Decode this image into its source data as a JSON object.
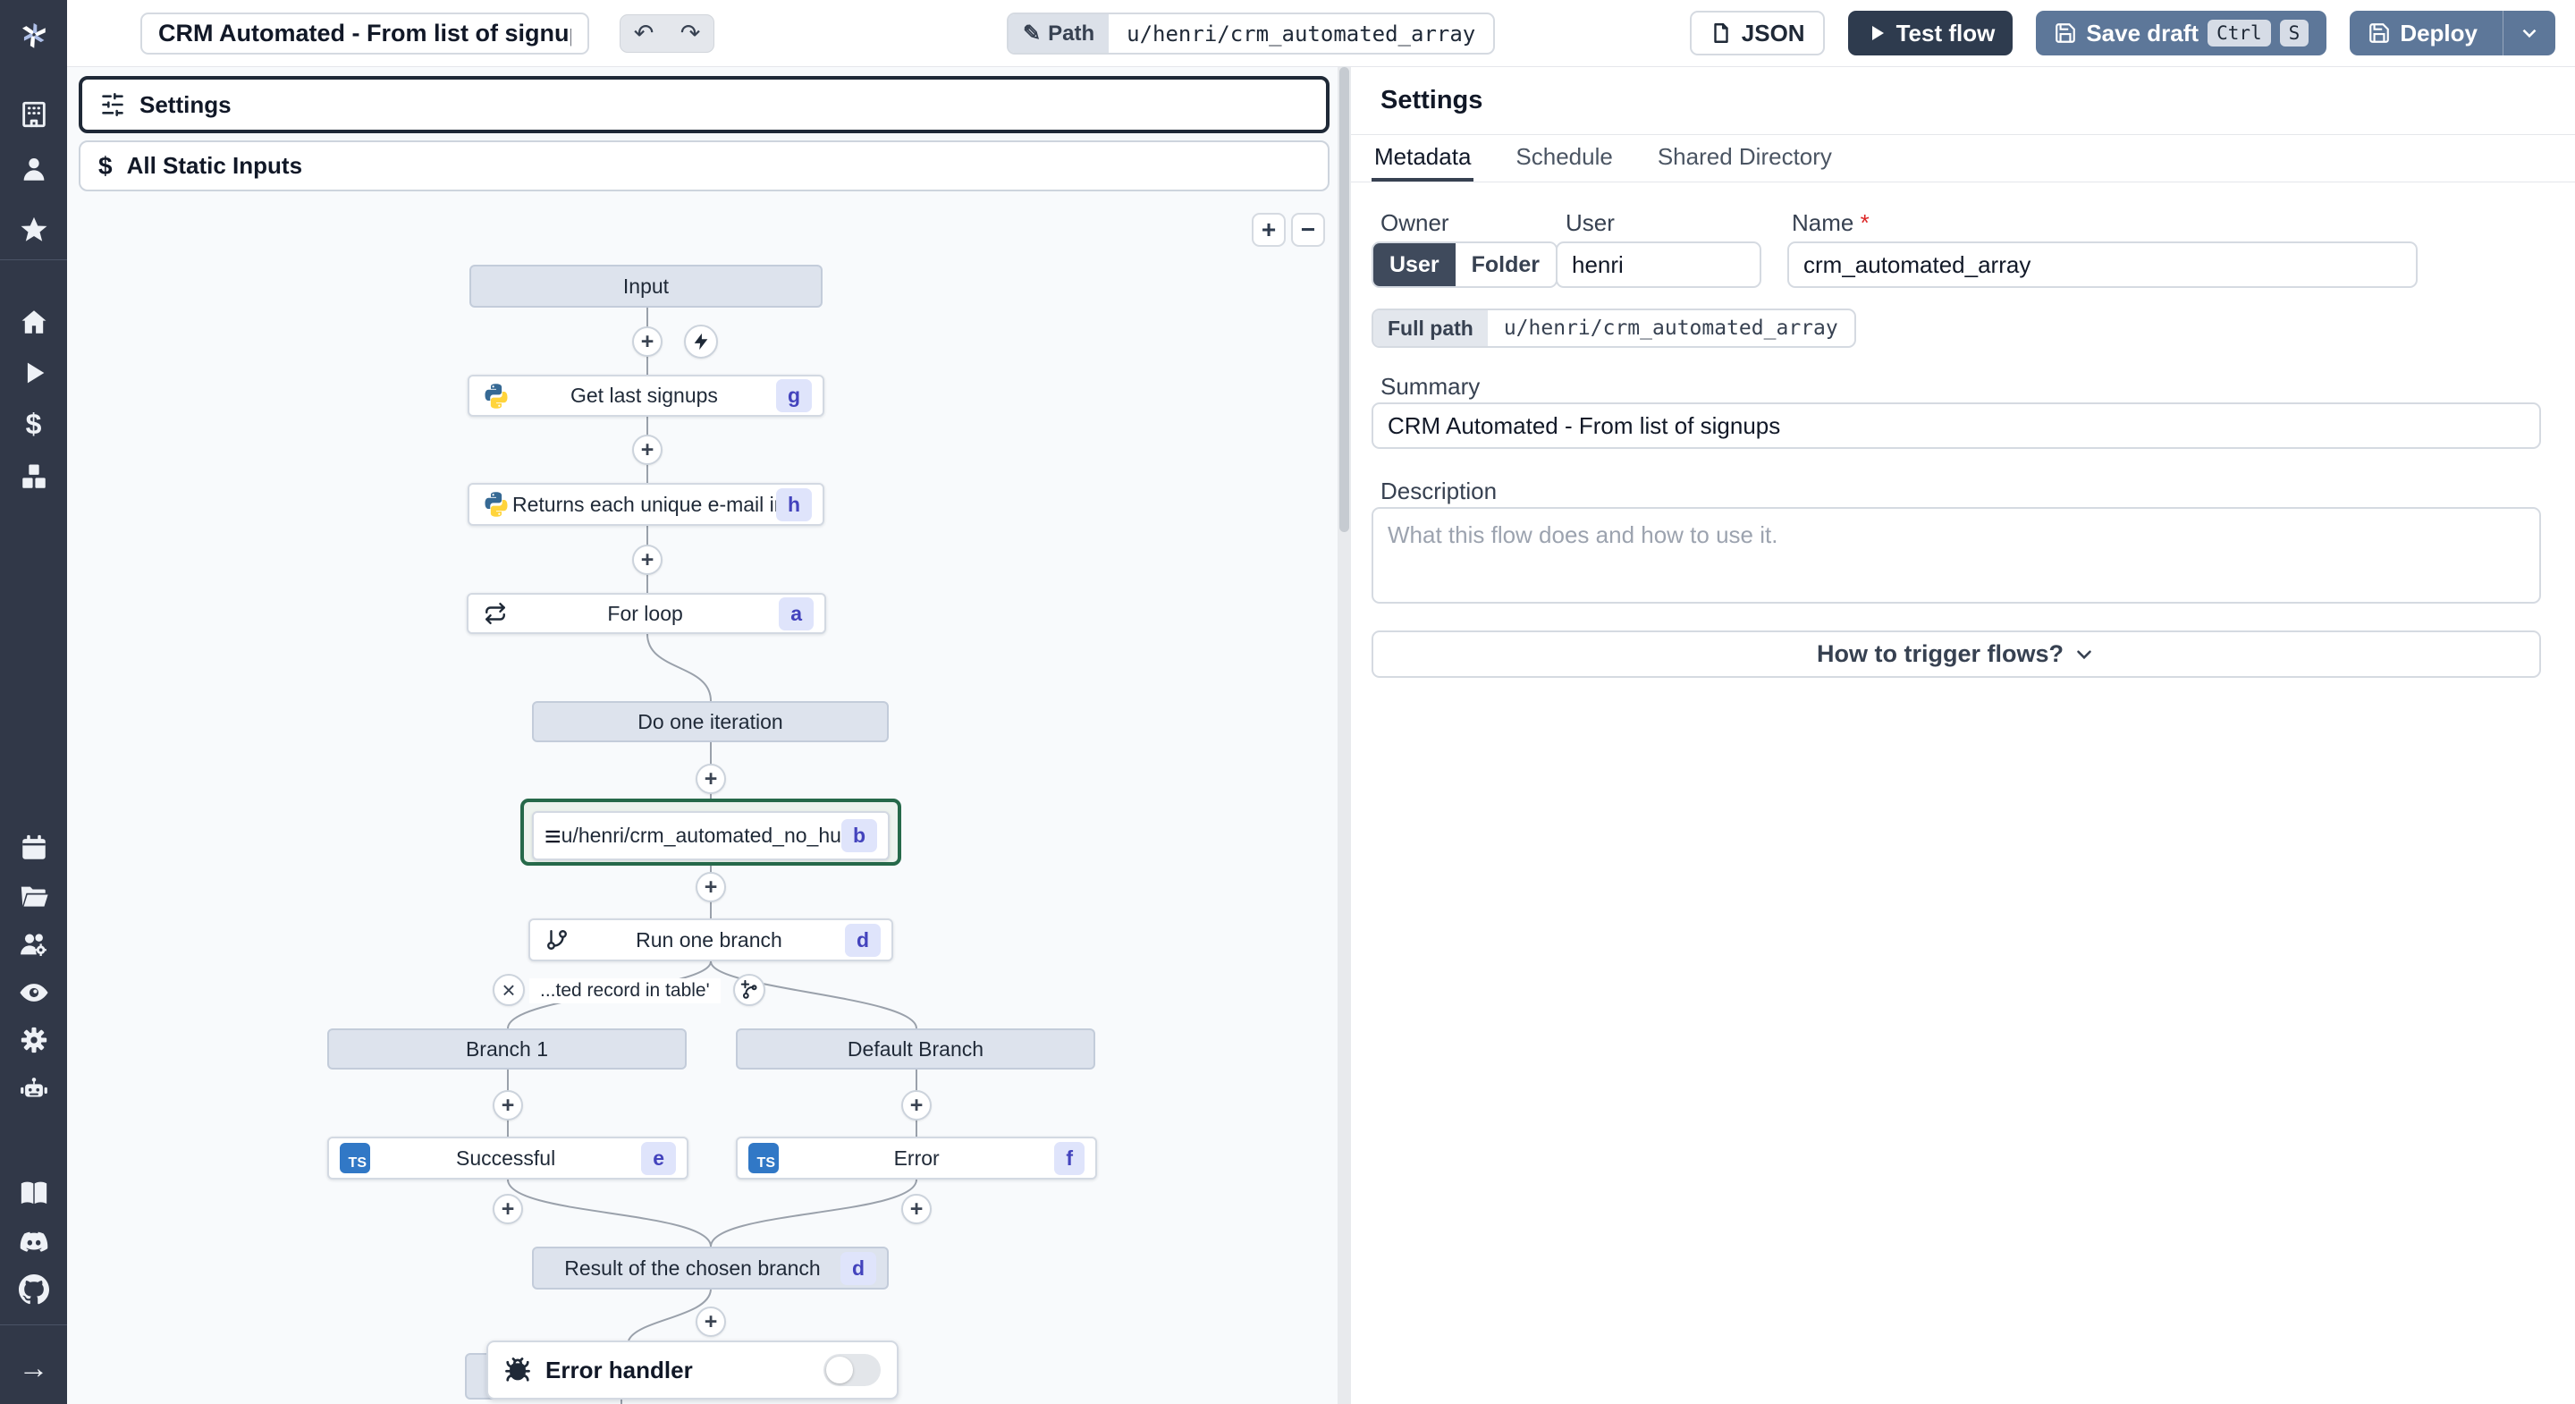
{
  "topbar": {
    "title_value": "CRM Automated - From list of signups",
    "path_label": "Path",
    "path_value": "u/henri/crm_automated_array",
    "json_button": "JSON",
    "test_flow_button": "Test flow",
    "save_draft_button": "Save draft",
    "kbd_ctrl": "Ctrl",
    "kbd_s": "S",
    "deploy_button": "Deploy"
  },
  "sidebar": {
    "icons": [
      "windmill-logo",
      "workspace",
      "user",
      "favorites",
      "home",
      "runs",
      "variables",
      "resources",
      "schedules",
      "folders",
      "groups",
      "audit-logs",
      "settings",
      "workers",
      "docs",
      "discord",
      "github",
      "expand"
    ]
  },
  "left_panel": {
    "settings_button": "Settings",
    "static_inputs_button": "All Static Inputs",
    "zoom_in": "+",
    "zoom_out": "−"
  },
  "flow": {
    "ts_label": "TS",
    "nodes": {
      "input": {
        "label": "Input"
      },
      "get_last_signups": {
        "label": "Get last signups",
        "badge": "g"
      },
      "unique_emails": {
        "label": "Returns each unique e-mail in an array",
        "badge": "h"
      },
      "for_loop": {
        "label": "For loop",
        "badge": "a"
      },
      "do_one_iteration": {
        "label": "Do one iteration"
      },
      "crm_no_human": {
        "label": "u/henri/crm_automated_no_human",
        "badge": "b"
      },
      "run_one_branch": {
        "label": "Run one branch",
        "badge": "d"
      },
      "branch_condition": {
        "label": "...ted record in table'"
      },
      "branch_1": {
        "label": "Branch 1"
      },
      "default_branch": {
        "label": "Default Branch"
      },
      "successful": {
        "label": "Successful",
        "badge": "e"
      },
      "error": {
        "label": "Error",
        "badge": "f"
      },
      "result": {
        "label": "Result of the chosen branch",
        "badge": "d"
      },
      "error_handler": {
        "label": "Error handler"
      }
    }
  },
  "right_panel": {
    "heading": "Settings",
    "tabs": {
      "metadata": "Metadata",
      "schedule": "Schedule",
      "shared_directory": "Shared Directory"
    },
    "owner_label": "Owner",
    "owner_user": "User",
    "owner_folder": "Folder",
    "user_label": "User",
    "user_value": "henri",
    "name_label": "Name",
    "name_required": "*",
    "name_value": "crm_automated_array",
    "full_path_label": "Full path",
    "full_path_value": "u/henri/crm_automated_array",
    "summary_label": "Summary",
    "summary_value": "CRM Automated - From list of signups",
    "description_label": "Description",
    "description_placeholder": "What this flow does and how to use it.",
    "how_to_trigger": "How to trigger flows?"
  },
  "colors": {
    "sidebar_bg": "#313848",
    "canvas_bg": "#f8fafc",
    "test_flow_button": "#2e3b4e",
    "deploy_button": "#5d7799",
    "selected_node_border": "#26694a",
    "node_badge_bg": "#dfe4fb",
    "node_badge_text": "#4343bd",
    "typescript_blue": "#3178c6",
    "gray_node_bg": "#dde3ed"
  }
}
